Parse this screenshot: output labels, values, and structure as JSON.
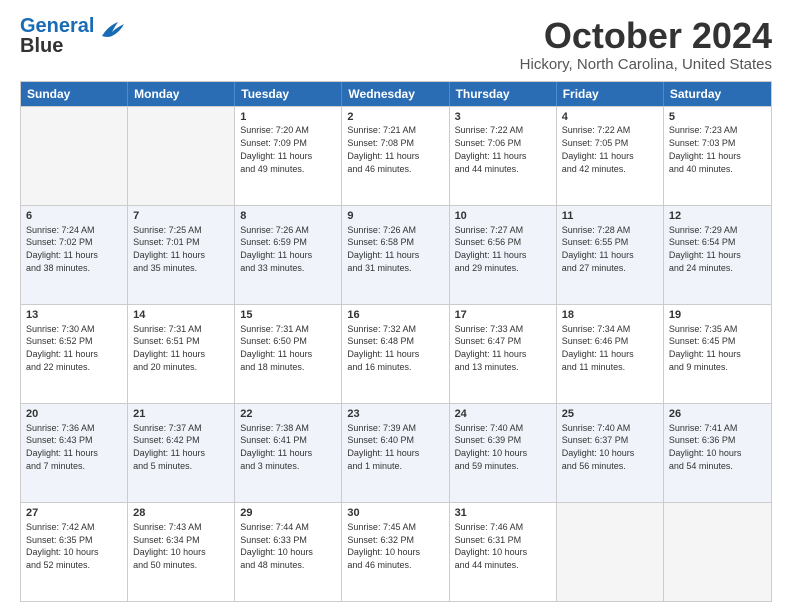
{
  "header": {
    "logo_line1": "General",
    "logo_line2": "Blue",
    "month": "October 2024",
    "location": "Hickory, North Carolina, United States"
  },
  "weekdays": [
    "Sunday",
    "Monday",
    "Tuesday",
    "Wednesday",
    "Thursday",
    "Friday",
    "Saturday"
  ],
  "rows": [
    [
      {
        "day": "",
        "info": ""
      },
      {
        "day": "",
        "info": ""
      },
      {
        "day": "1",
        "info": "Sunrise: 7:20 AM\nSunset: 7:09 PM\nDaylight: 11 hours\nand 49 minutes."
      },
      {
        "day": "2",
        "info": "Sunrise: 7:21 AM\nSunset: 7:08 PM\nDaylight: 11 hours\nand 46 minutes."
      },
      {
        "day": "3",
        "info": "Sunrise: 7:22 AM\nSunset: 7:06 PM\nDaylight: 11 hours\nand 44 minutes."
      },
      {
        "day": "4",
        "info": "Sunrise: 7:22 AM\nSunset: 7:05 PM\nDaylight: 11 hours\nand 42 minutes."
      },
      {
        "day": "5",
        "info": "Sunrise: 7:23 AM\nSunset: 7:03 PM\nDaylight: 11 hours\nand 40 minutes."
      }
    ],
    [
      {
        "day": "6",
        "info": "Sunrise: 7:24 AM\nSunset: 7:02 PM\nDaylight: 11 hours\nand 38 minutes."
      },
      {
        "day": "7",
        "info": "Sunrise: 7:25 AM\nSunset: 7:01 PM\nDaylight: 11 hours\nand 35 minutes."
      },
      {
        "day": "8",
        "info": "Sunrise: 7:26 AM\nSunset: 6:59 PM\nDaylight: 11 hours\nand 33 minutes."
      },
      {
        "day": "9",
        "info": "Sunrise: 7:26 AM\nSunset: 6:58 PM\nDaylight: 11 hours\nand 31 minutes."
      },
      {
        "day": "10",
        "info": "Sunrise: 7:27 AM\nSunset: 6:56 PM\nDaylight: 11 hours\nand 29 minutes."
      },
      {
        "day": "11",
        "info": "Sunrise: 7:28 AM\nSunset: 6:55 PM\nDaylight: 11 hours\nand 27 minutes."
      },
      {
        "day": "12",
        "info": "Sunrise: 7:29 AM\nSunset: 6:54 PM\nDaylight: 11 hours\nand 24 minutes."
      }
    ],
    [
      {
        "day": "13",
        "info": "Sunrise: 7:30 AM\nSunset: 6:52 PM\nDaylight: 11 hours\nand 22 minutes."
      },
      {
        "day": "14",
        "info": "Sunrise: 7:31 AM\nSunset: 6:51 PM\nDaylight: 11 hours\nand 20 minutes."
      },
      {
        "day": "15",
        "info": "Sunrise: 7:31 AM\nSunset: 6:50 PM\nDaylight: 11 hours\nand 18 minutes."
      },
      {
        "day": "16",
        "info": "Sunrise: 7:32 AM\nSunset: 6:48 PM\nDaylight: 11 hours\nand 16 minutes."
      },
      {
        "day": "17",
        "info": "Sunrise: 7:33 AM\nSunset: 6:47 PM\nDaylight: 11 hours\nand 13 minutes."
      },
      {
        "day": "18",
        "info": "Sunrise: 7:34 AM\nSunset: 6:46 PM\nDaylight: 11 hours\nand 11 minutes."
      },
      {
        "day": "19",
        "info": "Sunrise: 7:35 AM\nSunset: 6:45 PM\nDaylight: 11 hours\nand 9 minutes."
      }
    ],
    [
      {
        "day": "20",
        "info": "Sunrise: 7:36 AM\nSunset: 6:43 PM\nDaylight: 11 hours\nand 7 minutes."
      },
      {
        "day": "21",
        "info": "Sunrise: 7:37 AM\nSunset: 6:42 PM\nDaylight: 11 hours\nand 5 minutes."
      },
      {
        "day": "22",
        "info": "Sunrise: 7:38 AM\nSunset: 6:41 PM\nDaylight: 11 hours\nand 3 minutes."
      },
      {
        "day": "23",
        "info": "Sunrise: 7:39 AM\nSunset: 6:40 PM\nDaylight: 11 hours\nand 1 minute."
      },
      {
        "day": "24",
        "info": "Sunrise: 7:40 AM\nSunset: 6:39 PM\nDaylight: 10 hours\nand 59 minutes."
      },
      {
        "day": "25",
        "info": "Sunrise: 7:40 AM\nSunset: 6:37 PM\nDaylight: 10 hours\nand 56 minutes."
      },
      {
        "day": "26",
        "info": "Sunrise: 7:41 AM\nSunset: 6:36 PM\nDaylight: 10 hours\nand 54 minutes."
      }
    ],
    [
      {
        "day": "27",
        "info": "Sunrise: 7:42 AM\nSunset: 6:35 PM\nDaylight: 10 hours\nand 52 minutes."
      },
      {
        "day": "28",
        "info": "Sunrise: 7:43 AM\nSunset: 6:34 PM\nDaylight: 10 hours\nand 50 minutes."
      },
      {
        "day": "29",
        "info": "Sunrise: 7:44 AM\nSunset: 6:33 PM\nDaylight: 10 hours\nand 48 minutes."
      },
      {
        "day": "30",
        "info": "Sunrise: 7:45 AM\nSunset: 6:32 PM\nDaylight: 10 hours\nand 46 minutes."
      },
      {
        "day": "31",
        "info": "Sunrise: 7:46 AM\nSunset: 6:31 PM\nDaylight: 10 hours\nand 44 minutes."
      },
      {
        "day": "",
        "info": ""
      },
      {
        "day": "",
        "info": ""
      }
    ]
  ]
}
